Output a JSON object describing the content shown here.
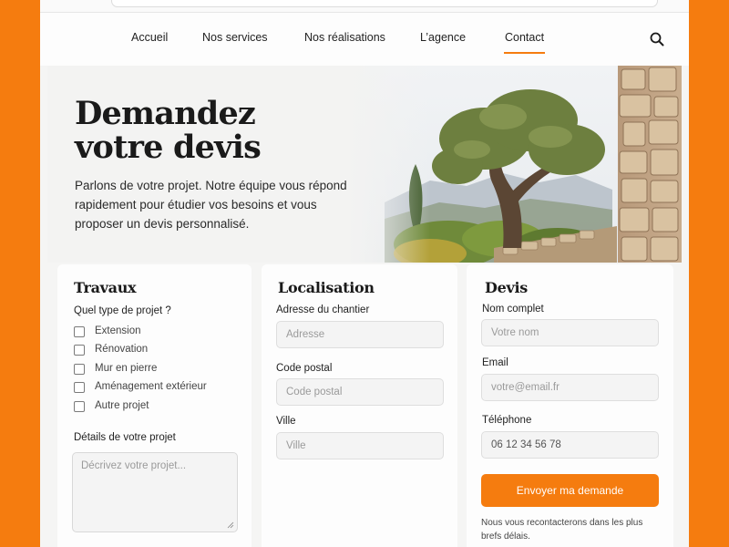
{
  "nav": {
    "items": [
      {
        "label": "Accueil"
      },
      {
        "label": "Nos services"
      },
      {
        "label": "Nos réalisations"
      },
      {
        "label": "L’agence"
      },
      {
        "label": "Contact",
        "active": true
      }
    ],
    "search_icon": "search-icon"
  },
  "hero": {
    "title_line1": "Demandez",
    "title_line2": "votre devis",
    "text": "Parlons de votre projet. Notre équipe vous répond rapidement pour étudier vos besoins et vous proposer un devis personnalisé."
  },
  "travaux": {
    "title": "Travaux",
    "question": "Quel type de projet ?",
    "options": [
      "Extension",
      "Rénovation",
      "Mur en pierre",
      "Aménagement extérieur",
      "Autre projet"
    ],
    "details_label": "Détails de votre projet",
    "details_placeholder": "Décrivez votre projet..."
  },
  "localisation": {
    "title": "Localisation",
    "address_label": "Adresse du chantier",
    "address_placeholder": "Adresse",
    "postal_label": "Code postal",
    "postal_placeholder": "Code postal",
    "city_label": "Ville",
    "city_placeholder": "Ville"
  },
  "devis": {
    "title": "Devis",
    "name_label": "Nom complet",
    "name_placeholder": "Votre nom",
    "email_label": "Email",
    "email_placeholder": "votre@email.fr",
    "phone_label": "Téléphone",
    "phone_value": "06 12 34 56 78",
    "submit_label": "Envoyer ma demande",
    "note": "Nous vous recontacterons dans les plus brefs délais."
  },
  "colors": {
    "accent": "#f57c0f",
    "background": "#f5f5f4"
  }
}
